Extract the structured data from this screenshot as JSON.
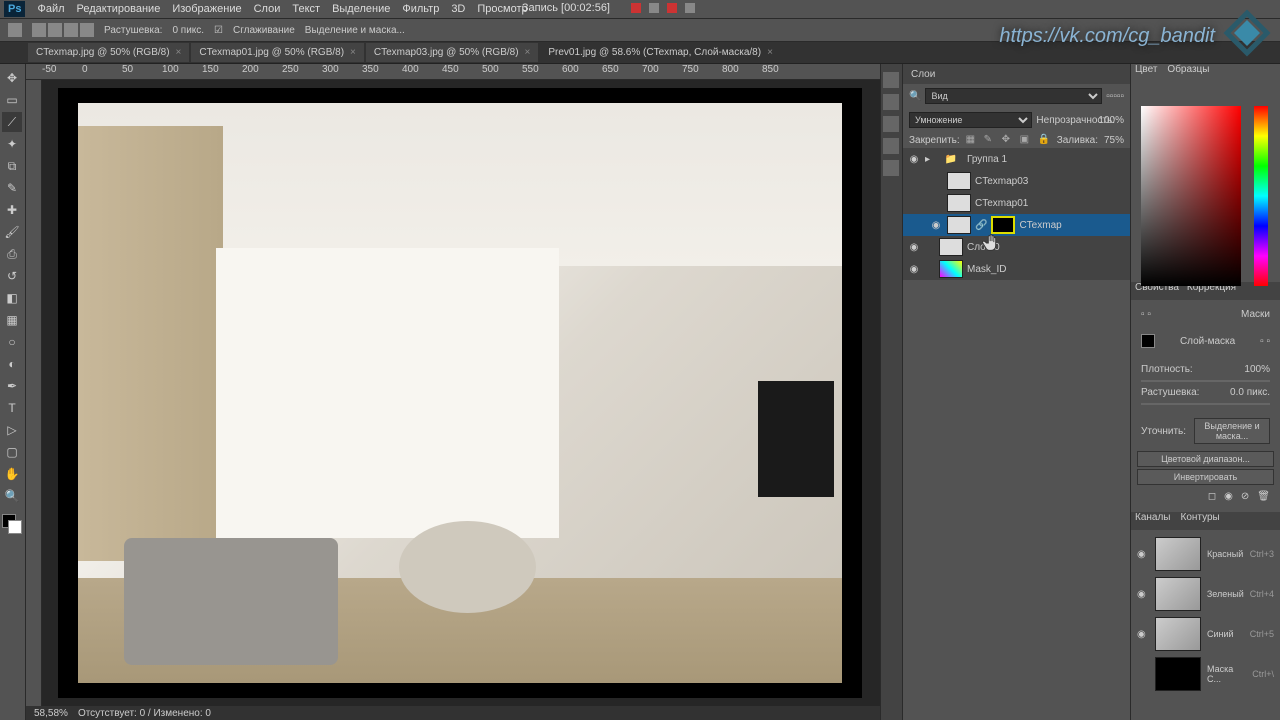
{
  "menu": [
    "Файл",
    "Редактирование",
    "Изображение",
    "Слои",
    "Текст",
    "Выделение",
    "Фильтр",
    "3D",
    "Просмотр"
  ],
  "recording": "Запись [00:02:56]",
  "url": "https://vk.com/cg_bandit",
  "optbar": {
    "rast": "Растушевка:",
    "rast_val": "0 пикс.",
    "smooth": "Сглаживание",
    "select_mask": "Выделение и маска..."
  },
  "tabs": [
    {
      "label": "CTexmap.jpg @ 50% (RGB/8)",
      "active": false
    },
    {
      "label": "CTexmap01.jpg @ 50% (RGB/8)",
      "active": false
    },
    {
      "label": "CTexmap03.jpg @ 50% (RGB/8)",
      "active": false
    },
    {
      "label": "Prev01.jpg @ 58.6% (CTexmap, Слой-маска/8)",
      "active": true
    }
  ],
  "ruler": [
    "-50",
    "0",
    "50",
    "100",
    "150",
    "200",
    "250",
    "300",
    "350",
    "400",
    "450",
    "500",
    "550",
    "600",
    "650",
    "700",
    "750",
    "800",
    "850"
  ],
  "layers_panel": {
    "title": "Слои",
    "kind": "Вид",
    "blend": "Умножение",
    "opacity_label": "Непрозрачность:",
    "opacity": "100%",
    "lock_label": "Закрепить:",
    "fill_label": "Заливка:",
    "fill": "75%"
  },
  "layers": [
    {
      "eye": "●",
      "type": "group",
      "name": "Группа 1",
      "indent": 0
    },
    {
      "eye": "",
      "type": "layer",
      "name": "CTexmap03",
      "indent": 1
    },
    {
      "eye": "",
      "type": "layer",
      "name": "CTexmap01",
      "indent": 1
    },
    {
      "eye": "●",
      "type": "masked",
      "name": "CTexmap",
      "indent": 1,
      "selected": true
    },
    {
      "eye": "●",
      "type": "layer",
      "name": "Слой 0",
      "indent": 0
    },
    {
      "eye": "●",
      "type": "layer",
      "name": "Mask_ID",
      "indent": 0,
      "colored": true
    }
  ],
  "color_tabs": [
    "Цвет",
    "Образцы"
  ],
  "props_tabs": [
    "Свойства",
    "Коррекция"
  ],
  "props": {
    "title": "Маски",
    "mask_label": "Слой-маска",
    "density_label": "Плотность:",
    "density": "100%",
    "feather_label": "Растушевка:",
    "feather": "0.0 пикс.",
    "refine_label": "Уточнить:",
    "btn1": "Выделение и маска...",
    "btn2": "Цветовой диапазон...",
    "btn3": "Инвертировать"
  },
  "channels_tabs": [
    "Каналы",
    "Контуры"
  ],
  "channels": [
    {
      "name": "Красный",
      "key": "Ctrl+3"
    },
    {
      "name": "Зеленый",
      "key": "Ctrl+4"
    },
    {
      "name": "Синий",
      "key": "Ctrl+5"
    },
    {
      "name": "Маска C...",
      "key": "Ctrl+\\",
      "mask": true
    }
  ],
  "status": {
    "zoom": "58,58%",
    "info": "Отсутствует: 0 / Изменено: 0"
  }
}
